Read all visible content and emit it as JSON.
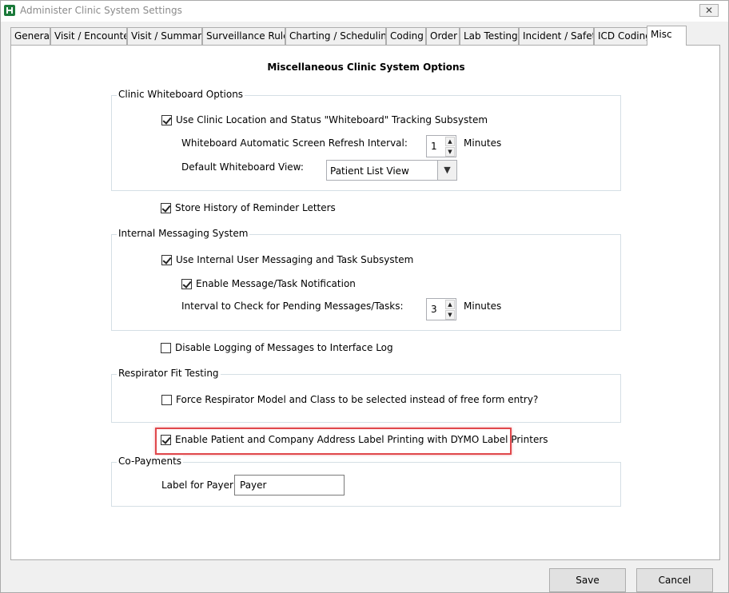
{
  "window": {
    "title": "Administer Clinic System Settings",
    "close_glyph": "✕"
  },
  "tabs": [
    {
      "label": "General"
    },
    {
      "label": "Visit / Encounter"
    },
    {
      "label": "Visit / Summary"
    },
    {
      "label": "Surveillance Rules"
    },
    {
      "label": "Charting / Scheduling"
    },
    {
      "label": "Coding"
    },
    {
      "label": "Order"
    },
    {
      "label": "Lab Testing"
    },
    {
      "label": "Incident / Safety"
    },
    {
      "label": "ICD Coding"
    },
    {
      "label": "Misc"
    }
  ],
  "active_tab": "Misc",
  "panel_title": "Miscellaneous Clinic System Options",
  "whiteboard": {
    "group_label": "Clinic Whiteboard Options",
    "use_whiteboard_label": "Use Clinic Location and Status \"Whiteboard\" Tracking Subsystem",
    "use_whiteboard_checked": true,
    "refresh_label": "Whiteboard Automatic Screen Refresh Interval:",
    "refresh_value": "1",
    "refresh_units": "Minutes",
    "default_view_label": "Default Whiteboard View:",
    "default_view_value": "Patient List View"
  },
  "reminder": {
    "label": "Store History of Reminder Letters",
    "checked": true
  },
  "messaging": {
    "group_label": "Internal Messaging System",
    "use_messaging_label": "Use Internal User Messaging and Task Subsystem",
    "use_messaging_checked": true,
    "notify_label": "Enable Message/Task Notification",
    "notify_checked": true,
    "interval_label": "Interval to Check for Pending Messages/Tasks:",
    "interval_value": "3",
    "interval_units": "Minutes"
  },
  "disable_logging": {
    "label": "Disable Logging of Messages to Interface Log",
    "checked": false
  },
  "respirator": {
    "group_label": "Respirator Fit Testing",
    "force_label": "Force Respirator Model and Class to be selected instead of free form entry?",
    "force_checked": false
  },
  "dymo": {
    "label": "Enable Patient and Company Address Label Printing with DYMO Label Printers",
    "checked": true
  },
  "copayments": {
    "group_label": "Co-Payments",
    "payer_label": "Label for Payer:",
    "payer_value": "Payer"
  },
  "buttons": {
    "save": "Save",
    "cancel": "Cancel"
  },
  "colors": {
    "highlight": "#e0484c",
    "app_icon": "#1b7a3a"
  }
}
